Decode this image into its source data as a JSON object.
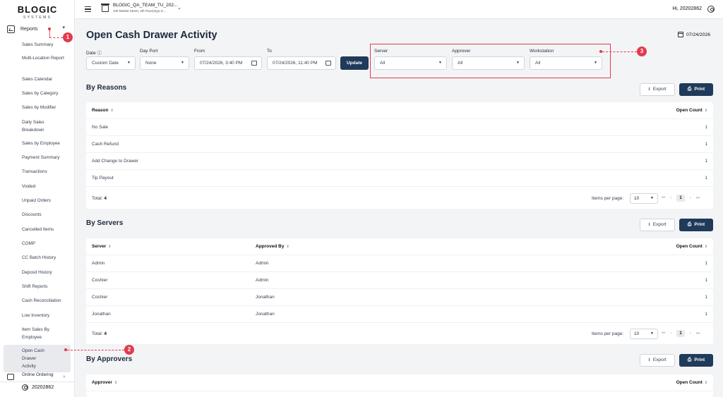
{
  "sidebar": {
    "logo": "BLOGIC",
    "logo_sub": "SYSTEMS",
    "reports_label": "Reports",
    "items": [
      "Sales Summary",
      "Multi-Location Report",
      "Sales Calendar",
      "Sales by Category",
      "Sales by Modifier",
      "Daily Sales Breakdown",
      "Sales by Employee",
      "Payment Summary",
      "Transactions",
      "Voided",
      "Unpaid Orders",
      "Discounts",
      "Cancelled Items",
      "COMP",
      "CC Batch History",
      "Deposit History",
      "Shift Reports",
      "Cash Reconciliation",
      "Low Inventory",
      "Item Sales By Employee",
      "Open Cash Drawer Activity"
    ],
    "online_ordering": "Online Ordering",
    "user": "20202862"
  },
  "header": {
    "store_name": "BLOGIC_QA_TEAM_TU_202...",
    "store_address": "109 Market Street, 4th Floor(Ing1-3-...",
    "greeting": "Hi, 20202862"
  },
  "page": {
    "title": "Open Cash Drawer Activity",
    "date": "07/24/2026"
  },
  "filters": {
    "date_label": "Date ⓘ",
    "date_value": "Custom Date",
    "day_port_label": "Day Port",
    "day_port_value": "None",
    "from_label": "From",
    "from_value": "07/24/2026, 3:40 PM",
    "to_label": "To",
    "to_value": "07/24/2026, 11:40 PM",
    "update_label": "Update",
    "server_label": "Server",
    "server_value": "All",
    "approver_label": "Approver",
    "approver_value": "All",
    "workstation_label": "Workstation",
    "workstation_value": "All"
  },
  "buttons": {
    "export": "Export",
    "print": "Print"
  },
  "reasons": {
    "title": "By Reasons",
    "headers": {
      "reason": "Reason",
      "count": "Open Count"
    },
    "rows": [
      {
        "reason": "No Sale",
        "count": "1"
      },
      {
        "reason": "Cash Refund",
        "count": "1"
      },
      {
        "reason": "Add Change to Drawer",
        "count": "1"
      },
      {
        "reason": "Tip Payout",
        "count": "1"
      }
    ],
    "total_label": "Total:",
    "total_value": "4",
    "ipp_label": "Items per page:",
    "ipp_value": "10",
    "page": "1"
  },
  "servers": {
    "title": "By Servers",
    "headers": {
      "server": "Server",
      "approved_by": "Approved By",
      "count": "Open Count"
    },
    "rows": [
      {
        "server": "Admin",
        "approved_by": "Admin",
        "count": "1"
      },
      {
        "server": "Coshier",
        "approved_by": "Admin",
        "count": "1"
      },
      {
        "server": "Coshier",
        "approved_by": "Jonathan",
        "count": "1"
      },
      {
        "server": "Jonathan",
        "approved_by": "Jonathan",
        "count": "1"
      }
    ],
    "total_label": "Total:",
    "total_value": "4",
    "ipp_label": "Items per page:",
    "ipp_value": "10",
    "page": "1"
  },
  "approvers": {
    "title": "By Approvers",
    "headers": {
      "approver": "Approver",
      "count": "Open Count"
    }
  },
  "callouts": [
    "1",
    "2",
    "3"
  ],
  "colors": {
    "accent": "#1f3a5a",
    "callout": "#e23a4e"
  }
}
